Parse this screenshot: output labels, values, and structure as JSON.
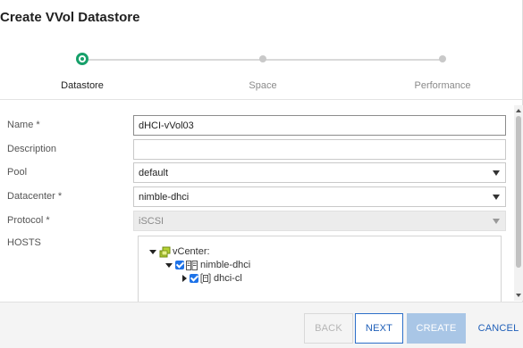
{
  "dialog": {
    "title": "Create VVol Datastore"
  },
  "stepper": {
    "steps": [
      {
        "label": "Datastore",
        "active": true
      },
      {
        "label": "Space",
        "active": false
      },
      {
        "label": "Performance",
        "active": false
      }
    ],
    "accent_color": "#17a06a"
  },
  "form": {
    "name": {
      "label": "Name *",
      "value": "dHCI-vVol03"
    },
    "description": {
      "label": "Description",
      "value": ""
    },
    "pool": {
      "label": "Pool",
      "value": "default"
    },
    "datacenter": {
      "label": "Datacenter *",
      "value": "nimble-dhci"
    },
    "protocol": {
      "label": "Protocol *",
      "value": "iSCSI",
      "disabled": true
    },
    "hosts": {
      "label": "HOSTS",
      "tree": [
        {
          "label": "vCenter:",
          "icon": "vcenter-icon",
          "expanded": true
        },
        {
          "label": "nimble-dhci",
          "icon": "datacenter-icon",
          "checked": true,
          "expanded": true
        },
        {
          "label": "dhci-cl",
          "icon": "cluster-icon",
          "checked": true,
          "expanded": false
        }
      ]
    }
  },
  "footer": {
    "back_label": "BACK",
    "next_label": "NEXT",
    "create_label": "CREATE",
    "cancel_label": "CANCEL"
  },
  "colors": {
    "primary_blue": "#1f5fb8",
    "checkbox_blue": "#1e73e8",
    "create_disabled": "#a9c6e6"
  }
}
